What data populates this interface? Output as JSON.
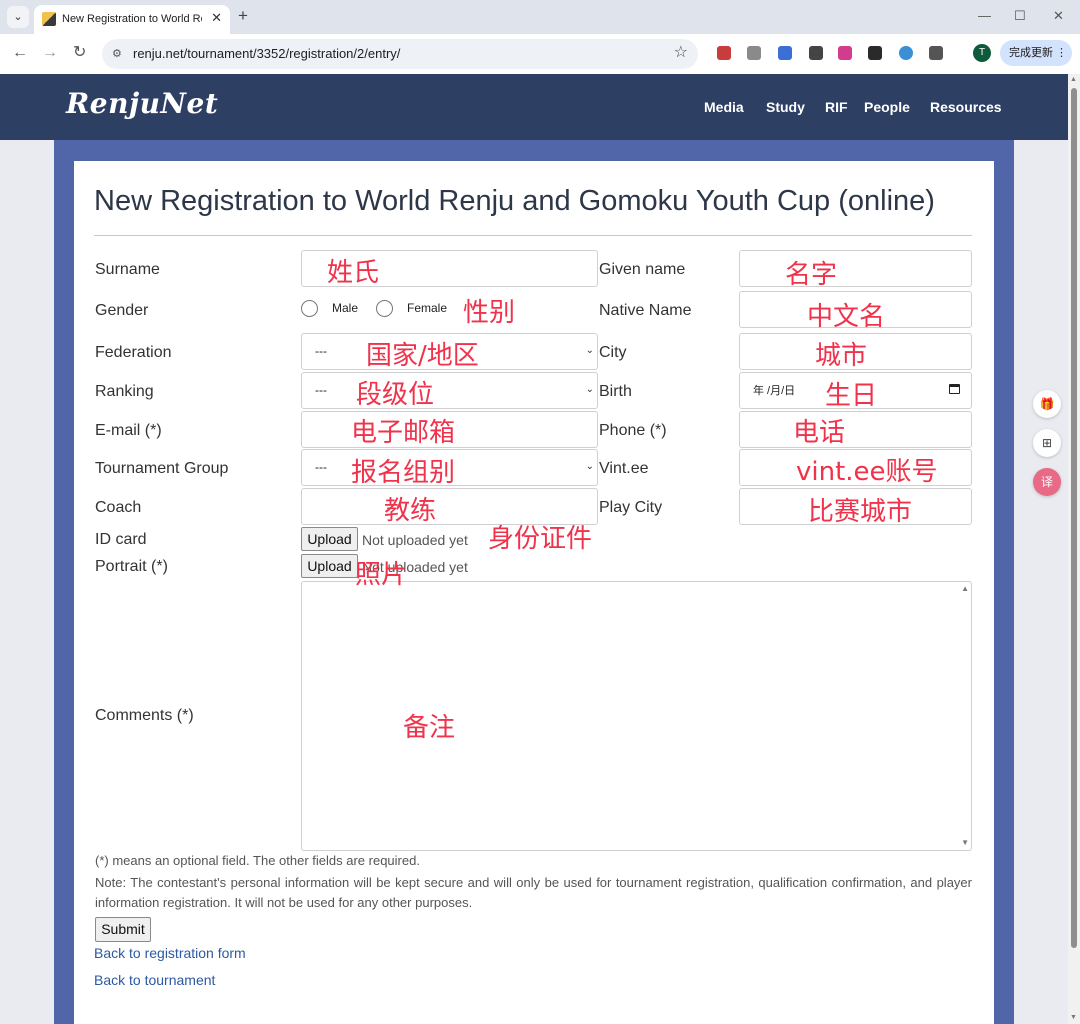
{
  "browser": {
    "tab_title": "New Registration to World Renju and Gomoku Youth Cup (online)",
    "url": "renju.net/tournament/3352/registration/2/entry/",
    "profile_initial": "T",
    "update_button": "完成更新 ⋮",
    "icons": {
      "tab_menu": "⌄",
      "tab_close": "✕",
      "new_tab": "+",
      "minimize": "—",
      "maximize": "☐",
      "close": "✕",
      "back": "←",
      "forward": "→",
      "reload": "↻",
      "site_info": "⚙",
      "bookmark": "☆"
    },
    "extension_colors": [
      "#c83c3c",
      "#8a8a8a",
      "#3b6fd6",
      "#444444",
      "#d23c8c",
      "#2a2a2a",
      "#3a8fd6",
      "#555555"
    ]
  },
  "site": {
    "logo": "RenjuNet",
    "nav": [
      "Media",
      "Study",
      "RIF",
      "People",
      "Resources"
    ],
    "colors": {
      "header": "#2e3f64",
      "band": "#5066a8",
      "link": "#2c5aa0",
      "annotation": "#f0324b"
    }
  },
  "form": {
    "title": "New Registration to World Renju and Gomoku Youth Cup (online)",
    "labels": {
      "surname": "Surname",
      "given_name": "Given name",
      "gender": "Gender",
      "native_name": "Native Name",
      "federation": "Federation",
      "city": "City",
      "ranking": "Ranking",
      "birth": "Birth",
      "email": "E-mail (*)",
      "phone": "Phone (*)",
      "group": "Tournament Group",
      "vintee": "Vint.ee",
      "coach": "Coach",
      "play_city": "Play City",
      "id_card": "ID card",
      "portrait": "Portrait (*)",
      "comments": "Comments (*)"
    },
    "gender_options": [
      "Male",
      "Female"
    ],
    "select_placeholder": "---",
    "birth_value": "年 /月/日",
    "upload_label": "Upload",
    "upload_status": "Not uploaded yet",
    "optional_note": "(*) means an optional field. The other fields are required.",
    "privacy_note": "Note: The contestant's personal information will be kept secure and will only be used for tournament registration, qualification confirmation, and player information registration. It will not be used for any other purposes.",
    "submit": "Submit",
    "back_form": "Back to registration form",
    "back_tournament": "Back to tournament"
  },
  "annotations": {
    "surname": "姓氏",
    "given_name": "名字",
    "gender": "性别",
    "native_name": "中文名",
    "federation": "国家/地区",
    "city": "城市",
    "ranking": "段级位",
    "birth": "生日",
    "email": "电子邮箱",
    "phone": "电话",
    "group": "报名组别",
    "vintee": "vint.ee账号",
    "coach": "教练",
    "play_city": "比赛城市",
    "id_card": "身份证件",
    "portrait": "照片",
    "comments": "备注"
  }
}
